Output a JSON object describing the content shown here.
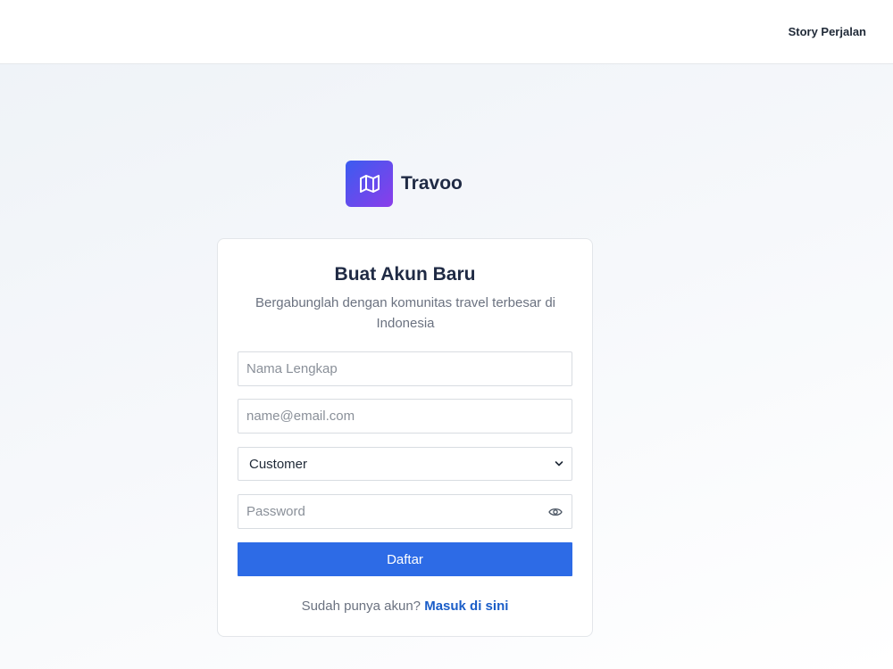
{
  "header": {
    "nav_link": "Story Perjalan"
  },
  "brand": {
    "logo_icon": "map-icon",
    "name": "Travoo"
  },
  "form": {
    "title": "Buat Akun Baru",
    "subtitle": "Bergabunglah dengan komunitas travel terbesar di Indonesia",
    "name_placeholder": "Nama Lengkap",
    "name_value": "",
    "email_placeholder": "name@email.com",
    "email_value": "",
    "role_selected": "Customer",
    "password_placeholder": "Password",
    "password_value": "",
    "password_toggle_icon": "eye-icon",
    "submit_label": "Daftar",
    "login_prompt": "Sudah punya akun?",
    "login_link": "Masuk di sini"
  },
  "colors": {
    "primary_button": "#2d6be6",
    "link": "#1a5dc8",
    "logo_gradient_start": "#3b5cf0",
    "logo_gradient_end": "#8b3dea"
  }
}
